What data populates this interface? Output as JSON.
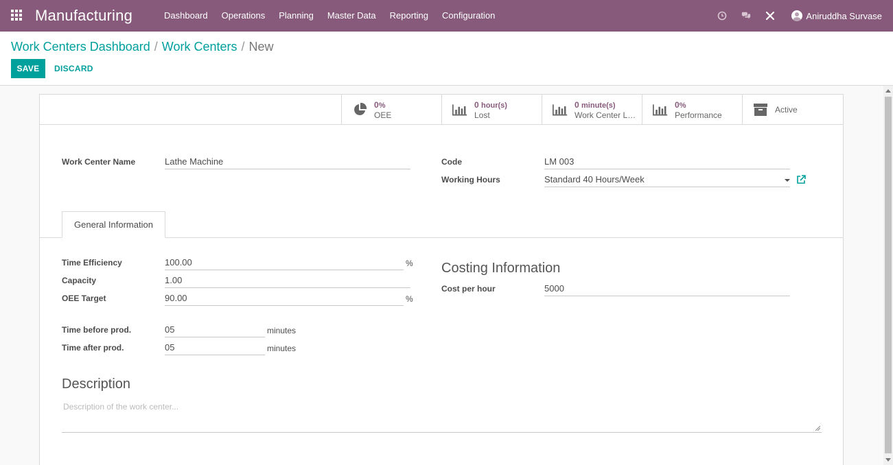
{
  "navbar": {
    "app_title": "Manufacturing",
    "menu": [
      "Dashboard",
      "Operations",
      "Planning",
      "Master Data",
      "Reporting",
      "Configuration"
    ],
    "user_name": "Aniruddha Survase",
    "icons": [
      "clock-icon",
      "chat-icon",
      "tools-icon"
    ],
    "bg_color": "#875a7b"
  },
  "breadcrumb": {
    "items": [
      "Work Centers Dashboard",
      "Work Centers"
    ],
    "separator": "/",
    "current": "New"
  },
  "actions": {
    "save_label": "SAVE",
    "discard_label": "DISCARD",
    "accent_color": "#00a09d"
  },
  "stat_buttons": [
    {
      "icon": "pie-chart-icon",
      "value": "0",
      "unit": "%",
      "label": "OEE"
    },
    {
      "icon": "bar-chart-icon",
      "value": "0",
      "unit": "hour(s)",
      "label": "Lost"
    },
    {
      "icon": "bar-chart-icon",
      "value": "0",
      "unit": "minute(s)",
      "label": "Work Center Lo..."
    },
    {
      "icon": "bar-chart-icon",
      "value": "0",
      "unit": "%",
      "label": "Performance"
    },
    {
      "icon": "archive-icon",
      "label": "Active"
    }
  ],
  "form": {
    "work_center_name_label": "Work Center Name",
    "work_center_name_value": "Lathe Machine",
    "code_label": "Code",
    "code_value": "LM 003",
    "working_hours_label": "Working Hours",
    "working_hours_value": "Standard 40 Hours/Week"
  },
  "tabs": [
    {
      "label": "General Information"
    }
  ],
  "general": {
    "time_efficiency_label": "Time Efficiency",
    "time_efficiency_value": "100.00",
    "time_efficiency_suffix": "%",
    "capacity_label": "Capacity",
    "capacity_value": "1.00",
    "oee_target_label": "OEE Target",
    "oee_target_value": "90.00",
    "oee_target_suffix": "%",
    "time_before_label": "Time before prod.",
    "time_before_value": "05",
    "time_before_suffix": "minutes",
    "time_after_label": "Time after prod.",
    "time_after_value": "05",
    "time_after_suffix": "minutes"
  },
  "costing": {
    "title": "Costing Information",
    "cost_per_hour_label": "Cost per hour",
    "cost_per_hour_value": "5000"
  },
  "description": {
    "title": "Description",
    "placeholder": "Description of the work center..."
  }
}
